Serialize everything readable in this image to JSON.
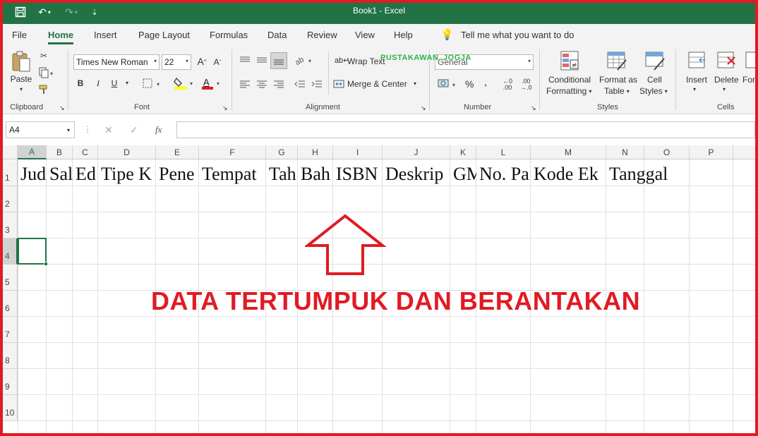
{
  "window": {
    "title": "Book1  -  Excel"
  },
  "tabs": [
    {
      "label": "File"
    },
    {
      "label": "Home"
    },
    {
      "label": "Insert"
    },
    {
      "label": "Page Layout"
    },
    {
      "label": "Formulas"
    },
    {
      "label": "Data"
    },
    {
      "label": "Review"
    },
    {
      "label": "View"
    },
    {
      "label": "Help"
    }
  ],
  "tell_me": "Tell me what you want to do",
  "ribbon": {
    "clipboard": {
      "paste": "Paste",
      "label": "Clipboard"
    },
    "font": {
      "name": "Times New Roman",
      "size": "22",
      "bold": "B",
      "italic": "I",
      "underline": "U",
      "grow": "A",
      "shrink": "A",
      "label": "Font"
    },
    "alignment": {
      "wrap": "Wrap Text",
      "merge": "Merge & Center",
      "label": "Alignment"
    },
    "number": {
      "format": "General",
      "percent": "%",
      "comma": ",",
      "label": "Number"
    },
    "styles": {
      "conditional1": "Conditional",
      "conditional2": "Formatting",
      "format_table1": "Format as",
      "format_table2": "Table",
      "cell_styles1": "Cell",
      "cell_styles2": "Styles",
      "label": "Styles"
    },
    "cells": {
      "insert": "Insert",
      "delete": "Delete",
      "format": "For",
      "label": "Cells"
    }
  },
  "watermark": "PUSTAKAWAN_JOGJA",
  "formula_bar": {
    "name_box": "A4",
    "fx": "fx",
    "value": ""
  },
  "columns": [
    "A",
    "B",
    "C",
    "D",
    "E",
    "F",
    "G",
    "H",
    "I",
    "J",
    "K",
    "L",
    "M",
    "N",
    "O",
    "P"
  ],
  "rows": [
    "1",
    "2",
    "3",
    "4",
    "5",
    "6",
    "7",
    "8",
    "9",
    "10"
  ],
  "row1_cells": [
    "Jud",
    "Sal",
    "Ed",
    "Tipe K",
    "Pene",
    "Tempat",
    "Tah",
    "Bah",
    "ISBN",
    "Deskrip",
    "GM",
    "No. Pa",
    "Kode Ek",
    "Tanggal"
  ],
  "annotation": "DATA TERTUMPUK DAN BERANTAKAN",
  "colors": {
    "excel_green": "#217346",
    "annotation_red": "#e01b24",
    "watermark_green": "#2db34a"
  }
}
